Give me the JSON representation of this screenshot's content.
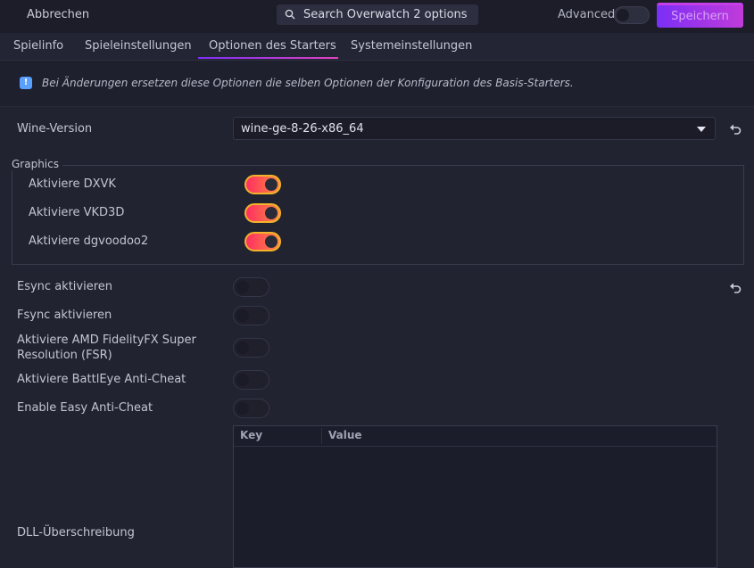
{
  "header": {
    "cancel_label": "Abbrechen",
    "search_placeholder": "Search Overwatch 2 options",
    "advanced_label": "Advanced",
    "advanced_on": false,
    "save_label": "Speichern"
  },
  "tabs": [
    {
      "label": "Spielinfo"
    },
    {
      "label": "Spieleinstellungen"
    },
    {
      "label": "Optionen des Starters",
      "active": true
    },
    {
      "label": "Systemeinstellungen"
    }
  ],
  "notice": {
    "icon": "info-icon",
    "text": "Bei Änderungen ersetzen diese Optionen die selben Optionen der Konfiguration des Basis-Starters."
  },
  "wine": {
    "label": "Wine-Version",
    "value": "wine-ge-8-26-x86_64"
  },
  "graphics": {
    "title": "Graphics",
    "options": [
      {
        "label": "Aktiviere DXVK",
        "on": true
      },
      {
        "label": "Aktiviere VKD3D",
        "on": true
      },
      {
        "label": "Aktiviere dgvoodoo2",
        "on": true
      }
    ]
  },
  "options": [
    {
      "label": "Esync aktivieren",
      "on": false
    },
    {
      "label": "Fsync aktivieren",
      "on": false
    },
    {
      "label": "Aktiviere AMD FidelityFX Super",
      "label2": "Resolution (FSR)",
      "on": false
    },
    {
      "label": "Aktiviere BattlEye Anti-Cheat",
      "on": false
    },
    {
      "label": "Enable Easy Anti-Cheat",
      "on": false
    }
  ],
  "dll": {
    "label": "DLL-Überschreibung",
    "col_key": "Key",
    "col_value": "Value"
  },
  "colors": {
    "accent_start": "#7b2ff7",
    "accent_end": "#e342c0",
    "toggle_on_start": "#ff2e63",
    "toggle_on_end": "#ff8a3d"
  }
}
